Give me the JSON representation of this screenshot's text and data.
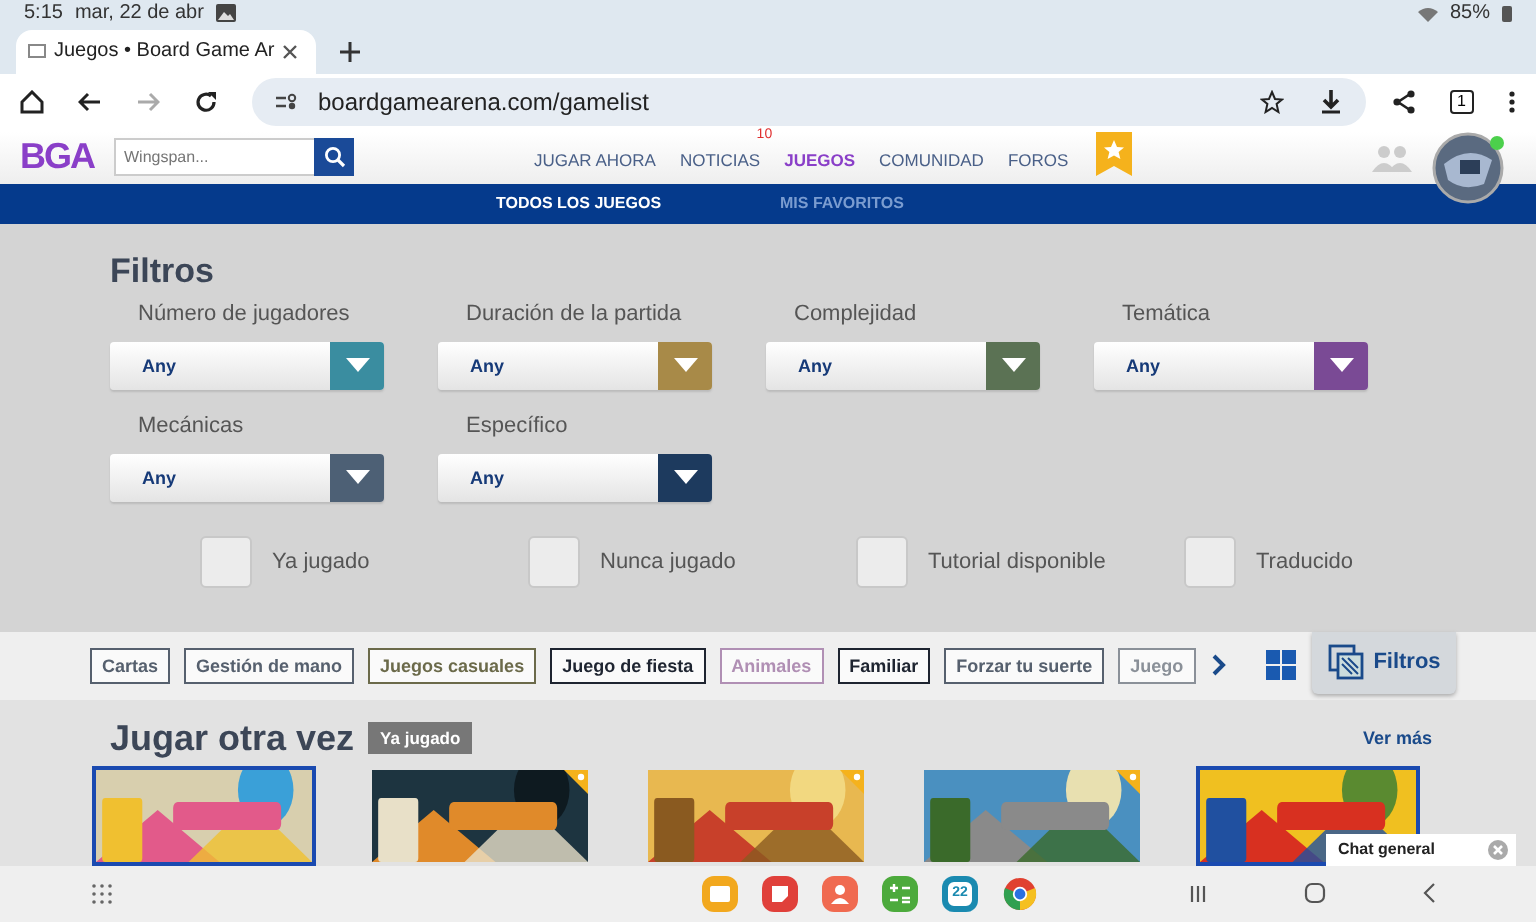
{
  "status_bar": {
    "time": "5:15",
    "date": "mar, 22 de abr",
    "battery": "85%"
  },
  "browser": {
    "tab_title": "Juegos • Board Game Ar",
    "url": "boardgamearena.com/gamelist",
    "tab_count": "1"
  },
  "site_header": {
    "logo": "BGA",
    "search": {
      "placeholder": "Wingspan..."
    },
    "nav": [
      {
        "label": "JUGAR AHORA",
        "selected": false
      },
      {
        "label": "NOTICIAS",
        "selected": false,
        "badge": "10"
      },
      {
        "label": "JUEGOS",
        "selected": true
      },
      {
        "label": "COMUNIDAD",
        "selected": false
      },
      {
        "label": "FOROS",
        "selected": false
      }
    ]
  },
  "subnav": [
    {
      "label": "TODOS LOS JUEGOS",
      "selected": true
    },
    {
      "label": "MIS FAVORITOS",
      "selected": false
    }
  ],
  "filters": {
    "title": "Filtros",
    "dropdowns": [
      {
        "label": "Número de jugadores",
        "value": "Any",
        "color": "#3a8da0"
      },
      {
        "label": "Duración de la partida",
        "value": "Any",
        "color": "#a88a48"
      },
      {
        "label": "Complejidad",
        "value": "Any",
        "color": "#5b7254"
      },
      {
        "label": "Temática",
        "value": "Any",
        "color": "#7a4a95"
      },
      {
        "label": "Mecánicas",
        "value": "Any",
        "color": "#4d6075"
      },
      {
        "label": "Específico",
        "value": "Any",
        "color": "#1d3a5e"
      }
    ],
    "checkboxes": [
      {
        "label": "Ya jugado",
        "checked": false
      },
      {
        "label": "Nunca jugado",
        "checked": false
      },
      {
        "label": "Tutorial disponible",
        "checked": false
      },
      {
        "label": "Traducido",
        "checked": false
      }
    ]
  },
  "tags": [
    {
      "label": "Cartas",
      "color": "#56606e"
    },
    {
      "label": "Gestión de mano",
      "color": "#56606e"
    },
    {
      "label": "Juegos casuales",
      "color": "#6b6a4a"
    },
    {
      "label": "Juego de fiesta",
      "color": "#1e2430"
    },
    {
      "label": "Animales",
      "color": "#b08fb4"
    },
    {
      "label": "Familiar",
      "color": "#1e2430"
    },
    {
      "label": "Forzar tu suerte",
      "color": "#56606e"
    },
    {
      "label": "Juego",
      "color": "#8a9098"
    }
  ],
  "filters_button": "Filtros",
  "section": {
    "title": "Jugar otra vez",
    "badge": "Ya jugado",
    "more": "Ver más",
    "games": [
      {
        "kind": "picture",
        "favorite": false,
        "selected": true
      },
      {
        "kind": "picture",
        "favorite": true,
        "selected": false
      },
      {
        "kind": "picture",
        "favorite": true,
        "selected": false
      },
      {
        "kind": "picture",
        "favorite": true,
        "selected": false
      },
      {
        "kind": "picture",
        "favorite": false,
        "selected": true
      }
    ]
  },
  "chat": {
    "title": "Chat general"
  },
  "taskbar": {
    "calendar_day": "22"
  }
}
